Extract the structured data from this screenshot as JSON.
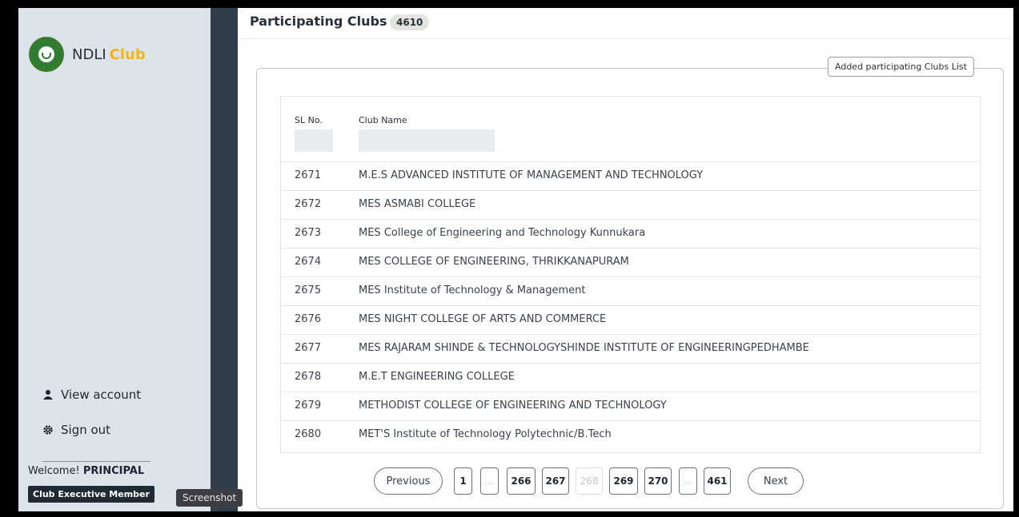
{
  "sidebar": {
    "brand_name": "NDLI",
    "brand_accent": "Club",
    "view_account": "View account",
    "sign_out": "Sign out",
    "welcome_prefix": "Welcome!",
    "welcome_user": "PRINCIPAL",
    "role": "Club Executive Member",
    "tooltip": "Screenshot"
  },
  "header": {
    "title": "Participating Clubs",
    "count": "4610"
  },
  "panel": {
    "legend": "Added participating Clubs List"
  },
  "table": {
    "columns": [
      "SL No.",
      "Club Name"
    ],
    "rows": [
      {
        "sl": "2671",
        "name": "M.E.S ADVANCED INSTITUTE OF MANAGEMENT AND TECHNOLOGY"
      },
      {
        "sl": "2672",
        "name": "MES ASMABI COLLEGE"
      },
      {
        "sl": "2673",
        "name": "MES College of Engineering and Technology Kunnukara"
      },
      {
        "sl": "2674",
        "name": "MES COLLEGE OF ENGINEERING, THRIKKANAPURAM"
      },
      {
        "sl": "2675",
        "name": "MES Institute of Technology & Management"
      },
      {
        "sl": "2676",
        "name": "MES NIGHT COLLEGE OF ARTS AND COMMERCE"
      },
      {
        "sl": "2677",
        "name": "MES RAJARAM SHINDE & TECHNOLOGYSHINDE INSTITUTE OF ENGINEERINGPEDHAMBE"
      },
      {
        "sl": "2678",
        "name": "M.E.T ENGINEERING COLLEGE"
      },
      {
        "sl": "2679",
        "name": "METHODIST COLLEGE OF ENGINEERING AND TECHNOLOGY"
      },
      {
        "sl": "2680",
        "name": "MET'S Institute of Technology Polytechnic/B.Tech"
      }
    ]
  },
  "pagination": {
    "previous": "Previous",
    "next": "Next",
    "pages": [
      "1",
      "...",
      "266",
      "267",
      "268",
      "269",
      "270",
      "...",
      "461"
    ],
    "current": "268"
  },
  "colors": {
    "sidebar_bg": "#dde3ea",
    "rail_bg": "#2f3e4a",
    "brand_accent": "#f2b515",
    "badge_bg": "#1f2a33"
  }
}
